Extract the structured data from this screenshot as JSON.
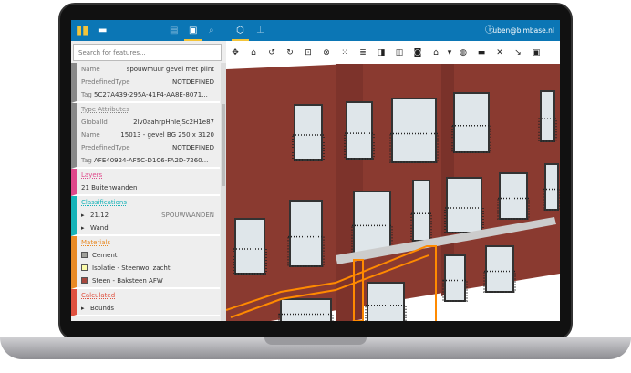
{
  "header": {
    "user": "ruben@bimbase.nl",
    "icons": [
      "logo-icon",
      "folder-icon",
      "files-icon",
      "clipboard-icon",
      "search-icon",
      "cube-icon",
      "tree-icon",
      "info-icon"
    ]
  },
  "search": {
    "placeholder": "Search for features..."
  },
  "attributes": [
    {
      "k": "Name",
      "v": "spouwmuur gevel met plint"
    },
    {
      "k": "PredefinedType",
      "v": "NOTDEFINED"
    },
    {
      "k": "Tag",
      "v": "5C27A439-295A-41F4-AA8E-8071..."
    }
  ],
  "type_attributes": {
    "title": "Type Attributes",
    "rows": [
      {
        "k": "GlobalId",
        "v": "2lv0aahrpHnlejSc2H1e87"
      },
      {
        "k": "Name",
        "v": "15013 - gevel BG 250 x 3120"
      },
      {
        "k": "PredefinedType",
        "v": "NOTDEFINED"
      },
      {
        "k": "Tag",
        "v": "AFE40924-AF5C-D1C6-FA2D-7260..."
      }
    ]
  },
  "layers": {
    "title": "Layers",
    "value": "21 Buitenwanden",
    "color": "#e0478a"
  },
  "classifications": {
    "title": "Classifications",
    "rows": [
      {
        "k": "21.12",
        "v": "SPOUWWANDEN"
      },
      {
        "k": "Wand",
        "v": ""
      }
    ],
    "color": "#15b3b8"
  },
  "materials": {
    "title": "Materials",
    "items": [
      {
        "name": "Cement",
        "color": "#a0a09a"
      },
      {
        "name": "Isolatie - Steenwol zacht",
        "color": "#fafaa8"
      },
      {
        "name": "Steen - Baksteen AFW",
        "color": "#a8483e"
      }
    ],
    "color": "#e98a24"
  },
  "calculated": {
    "title": "Calculated",
    "rows": [
      "Bounds"
    ],
    "color": "#e0513f"
  },
  "toolbar": [
    "pan-icon",
    "home-icon",
    "rotate-left-icon",
    "rotate-right-icon",
    "fit-icon",
    "isolate-icon",
    "explode-icon",
    "settings-icon",
    "section-icon",
    "plan-icon",
    "camera-icon",
    "house-icon",
    "dropdown-icon",
    "globe-icon",
    "measure-icon",
    "tools-icon",
    "export-icon",
    "user-icon"
  ],
  "toolbar_glyphs": [
    "✥",
    "⌂",
    "↺",
    "↻",
    "⊡",
    "⊗",
    "⁙",
    "≣",
    "◨",
    "◫",
    "◙",
    "⌂",
    "▾",
    "◍",
    "▬",
    "✕",
    "↘",
    "▣"
  ]
}
